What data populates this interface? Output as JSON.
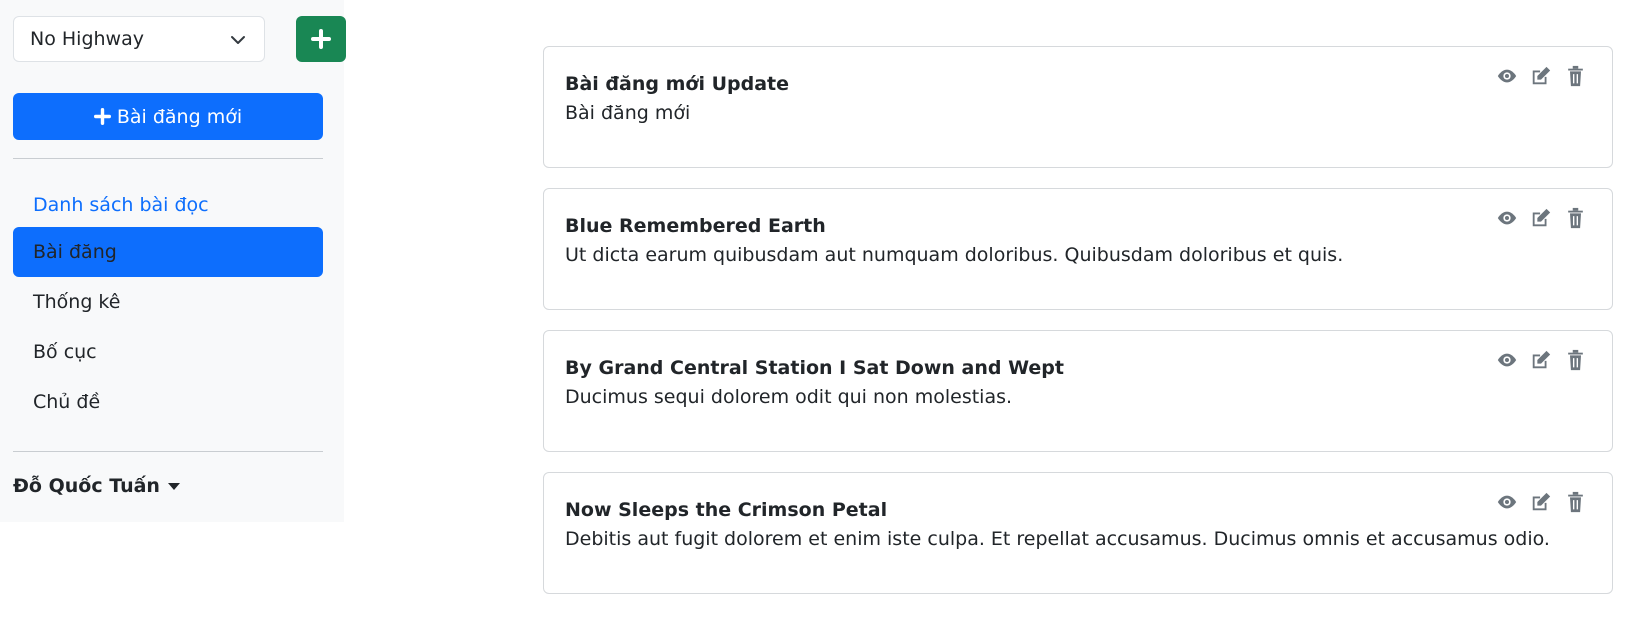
{
  "sidebar": {
    "highway_select": {
      "value": "No Highway"
    },
    "new_post_label": "Bài đăng mới",
    "nav_items": [
      {
        "label": "Danh sách bài đọc"
      },
      {
        "label": "Bài đăng"
      },
      {
        "label": "Thống kê"
      },
      {
        "label": "Bố cục"
      },
      {
        "label": "Chủ đề"
      }
    ],
    "user_name": "Đỗ Quốc Tuấn"
  },
  "posts": [
    {
      "title": "Bài đăng mới Update",
      "summary": "Bài đăng mới"
    },
    {
      "title": "Blue Remembered Earth",
      "summary": "Ut dicta earum quibusdam aut numquam doloribus. Quibusdam doloribus et quis."
    },
    {
      "title": "By Grand Central Station I Sat Down and Wept",
      "summary": "Ducimus sequi dolorem odit qui non molestias."
    },
    {
      "title": "Now Sleeps the Crimson Petal",
      "summary": "Debitis aut fugit dolorem et enim iste culpa. Et repellat accusamus. Ducimus omnis et accusamus odio."
    }
  ],
  "colors": {
    "primary": "#0d6efd",
    "success": "#198754",
    "icon_gray": "#6c757d",
    "sidebar_bg": "#f8f9fa"
  },
  "icons": {
    "view": "eye-icon",
    "edit": "edit-icon",
    "delete": "trash-icon"
  }
}
